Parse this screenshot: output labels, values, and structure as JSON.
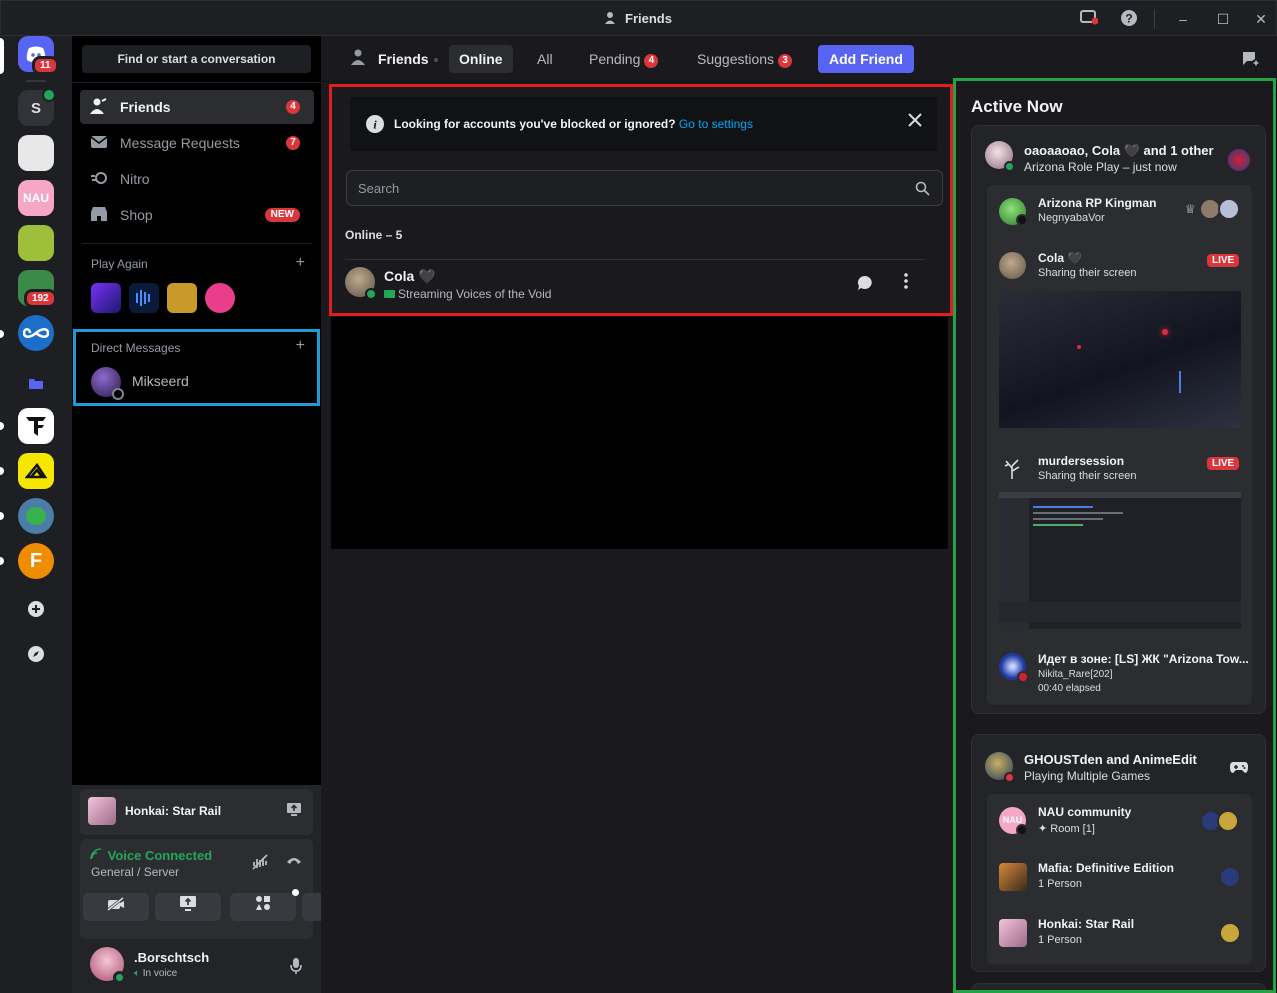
{
  "window": {
    "title": "Friends"
  },
  "rail": {
    "home_badge": "11",
    "server_s_letter": "S",
    "server_badge": "192"
  },
  "sidebar": {
    "search_label": "Find or start a conversation",
    "nav": [
      {
        "label": "Friends",
        "count": "4"
      },
      {
        "label": "Message Requests",
        "count": "7"
      },
      {
        "label": "Nitro"
      },
      {
        "label": "Shop",
        "tag": "NEW"
      }
    ],
    "play_again": "Play Again",
    "direct_messages": "Direct Messages",
    "dm_user": "Mikseerd"
  },
  "userpanel": {
    "activity": "Honkai: Star Rail",
    "voice_status": "Voice Connected",
    "voice_channel": "General / Server",
    "username": ".Borschtsch",
    "user_status": "In voice"
  },
  "header": {
    "title": "Friends",
    "tabs": [
      {
        "label": "Online"
      },
      {
        "label": "All"
      },
      {
        "label": "Pending",
        "count": "4"
      },
      {
        "label": "Suggestions",
        "count": "3"
      }
    ],
    "add_friend": "Add Friend"
  },
  "main": {
    "notice_text": "Looking for accounts you've blocked or ignored?",
    "notice_link": "Go to settings",
    "search_placeholder": "Search",
    "online_header": "Online – 5",
    "friend": {
      "name": "Cola",
      "status": "Streaming Voices of the Void"
    }
  },
  "active_now": {
    "title": "Active Now",
    "card1": {
      "heading": "oaoaaoao, Cola 🖤 and 1 other",
      "sub": "Arizona Role Play – just now",
      "items": [
        {
          "name": "Arizona RP Kingman",
          "sub": "NegnyabaVor"
        },
        {
          "name": "Cola 🖤",
          "sub": "Sharing their screen",
          "live": "LIVE"
        },
        {
          "name": "murdersession",
          "sub": "Sharing their screen",
          "live": "LIVE"
        },
        {
          "name": "Идет в зоне: [LS] ЖК \"Arizona Tow...",
          "sub": "Nikita_Rare[202]",
          "sub2": "00:40 elapsed"
        }
      ]
    },
    "card2": {
      "heading": "GHOUSTden and AnimeEdit",
      "sub": "Playing Multiple Games",
      "items": [
        {
          "name": "NAU community",
          "sub": "✦ Room [1]"
        },
        {
          "name": "Mafia: Definitive Edition",
          "sub": "1 Person"
        },
        {
          "name": "Honkai: Star Rail",
          "sub": "1 Person"
        }
      ]
    }
  }
}
